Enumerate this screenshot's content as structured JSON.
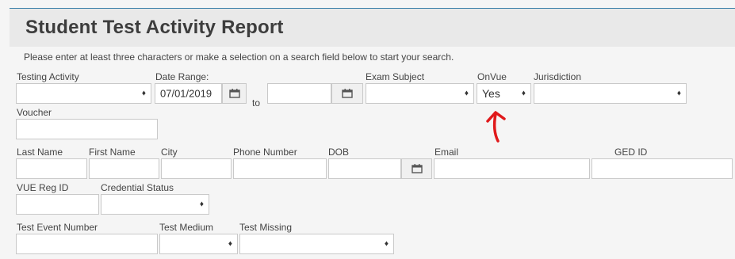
{
  "page": {
    "title": "Student Test Activity Report",
    "instructions": "Please enter at least three characters or make a selection on a search field below to start your search."
  },
  "labels": {
    "testing_activity": "Testing Activity",
    "date_range": "Date Range:",
    "to": "to",
    "exam_subject": "Exam Subject",
    "onvue": "OnVue",
    "jurisdiction": "Jurisdiction",
    "voucher": "Voucher",
    "last_name": "Last Name",
    "first_name": "First Name",
    "city": "City",
    "phone_number": "Phone Number",
    "dob": "DOB",
    "email": "Email",
    "ged_id": "GED ID",
    "vue_reg_id": "VUE Reg ID",
    "credential_status": "Credential Status",
    "test_event_number": "Test Event Number",
    "test_medium": "Test Medium",
    "test_missing": "Test Missing"
  },
  "values": {
    "date_from": "07/01/2019",
    "date_to": "",
    "onvue": "Yes"
  },
  "icons": {
    "calendar": "calendar-icon",
    "select_arrow": "select-arrows-icon",
    "annotation": "red-arrow-annotation"
  },
  "colors": {
    "accent_line": "#3a7fa8",
    "annotation": "#e0191b"
  }
}
